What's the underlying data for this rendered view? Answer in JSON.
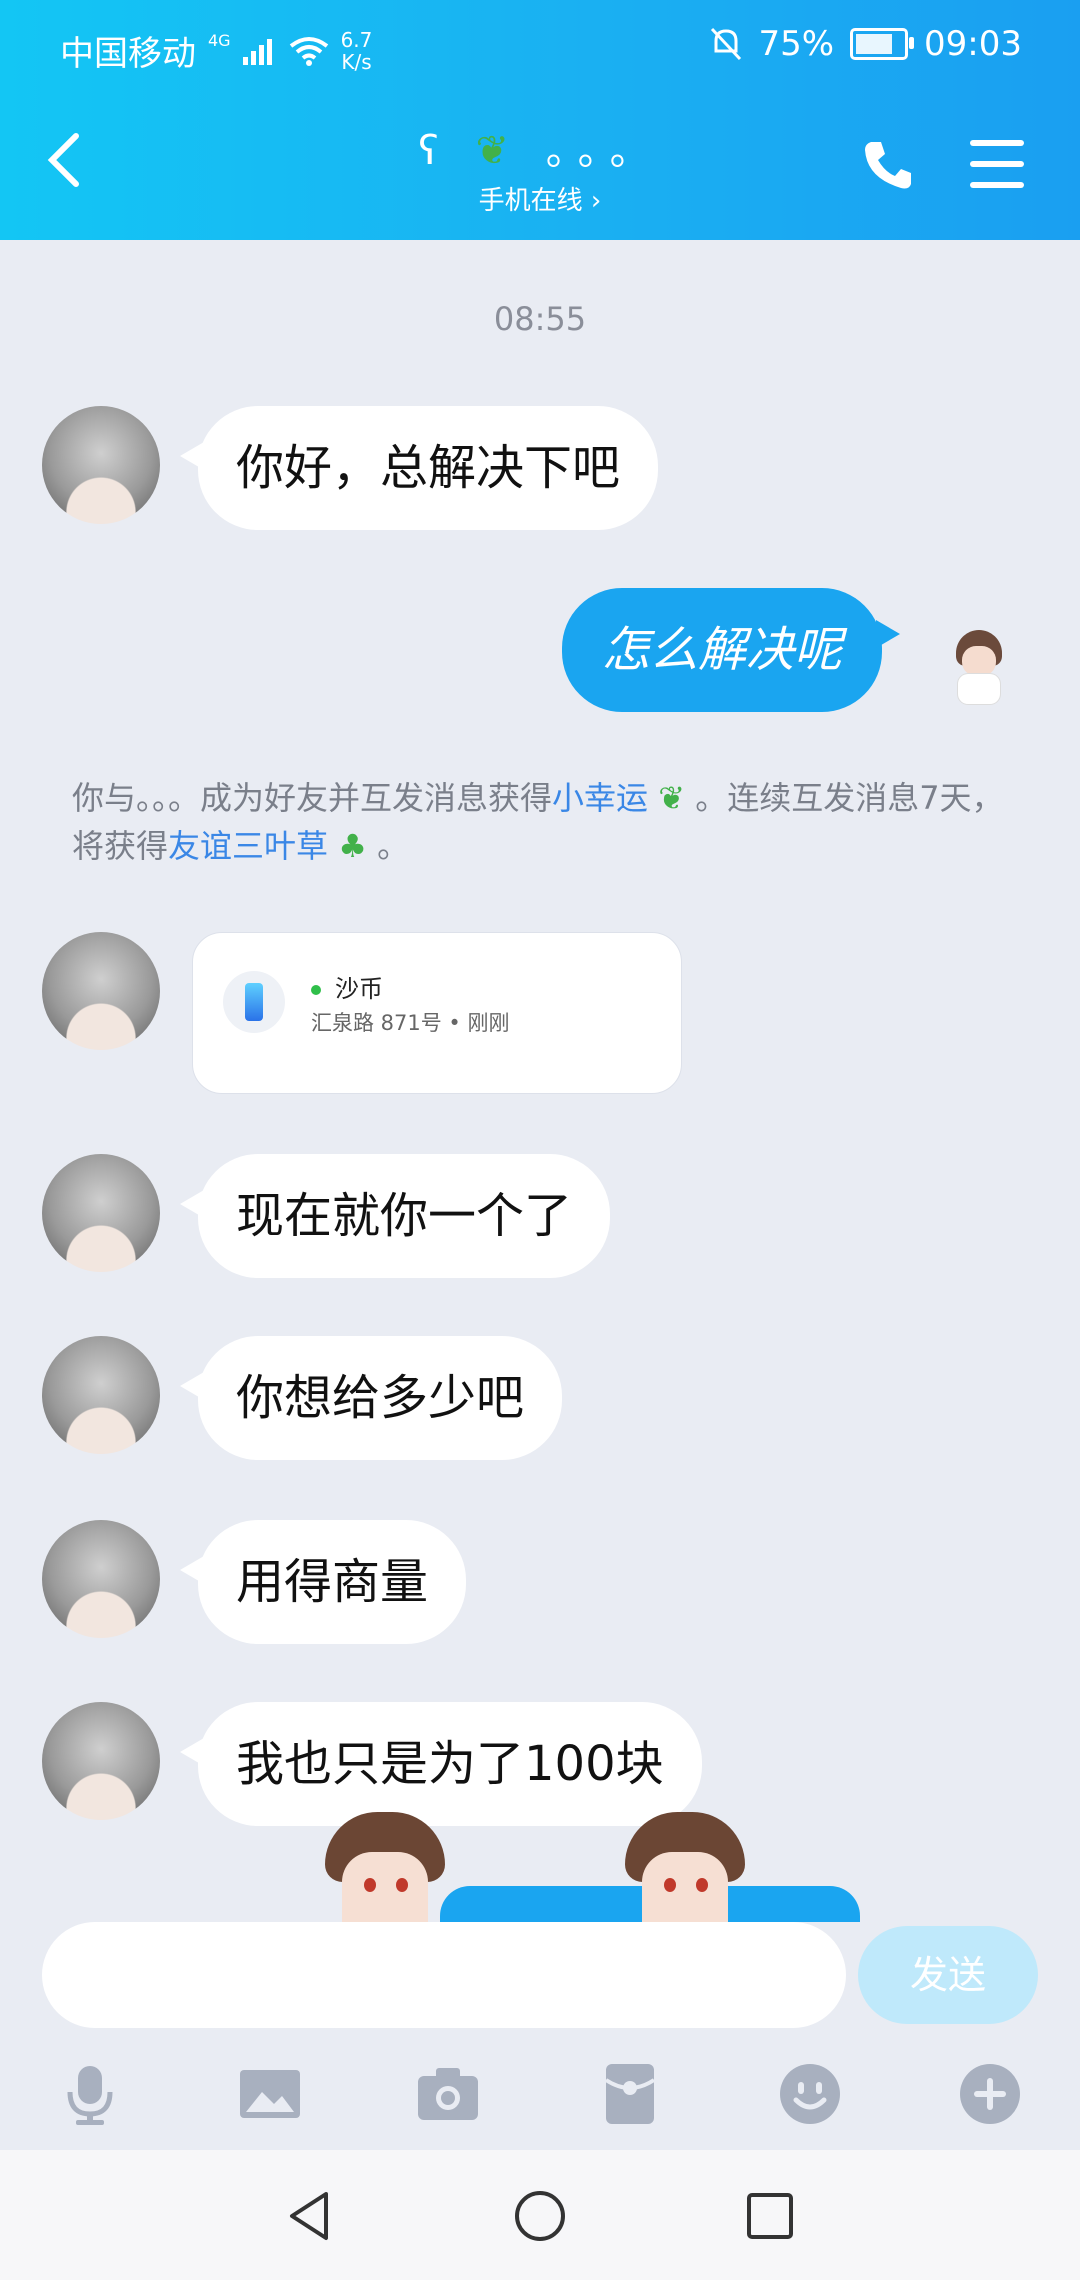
{
  "status_bar": {
    "carrier": "中国移动",
    "network": "4G",
    "speed": "6.7\nK/s",
    "battery": "75%",
    "time": "09:03"
  },
  "header": {
    "title": "。。。",
    "subtitle": "手机在线 ›",
    "back_icon": "chevron-left-icon",
    "call_icon": "phone-icon",
    "menu_icon": "menu-icon"
  },
  "chat": {
    "timestamp": "08:55",
    "messages": [
      {
        "from": "other",
        "text": "你好，总解决下吧"
      },
      {
        "from": "me",
        "text": "怎么解决呢"
      },
      {
        "from": "other",
        "text": "现在就你一个了"
      },
      {
        "from": "other",
        "text": "你想给多少吧"
      },
      {
        "from": "other",
        "text": "用得商量"
      },
      {
        "from": "other",
        "text": "我也只是为了100块"
      }
    ],
    "notice": {
      "part1": "你与。。。成为好友并互发消息获得",
      "link1": "小幸运",
      "part2": "。连续互发消息7天，将获得",
      "link2": "友谊三叶草",
      "part3": "。"
    },
    "location_card": {
      "name": "沙币",
      "address": "汇泉路 871号 • 刚刚"
    }
  },
  "composer": {
    "input_value": "",
    "send_label": "发送",
    "tools": [
      "mic-icon",
      "image-icon",
      "camera-icon",
      "red-packet-icon",
      "emoji-icon",
      "plus-icon"
    ]
  },
  "colors": {
    "accent": "#1aa5f0",
    "link": "#3a87e6"
  }
}
